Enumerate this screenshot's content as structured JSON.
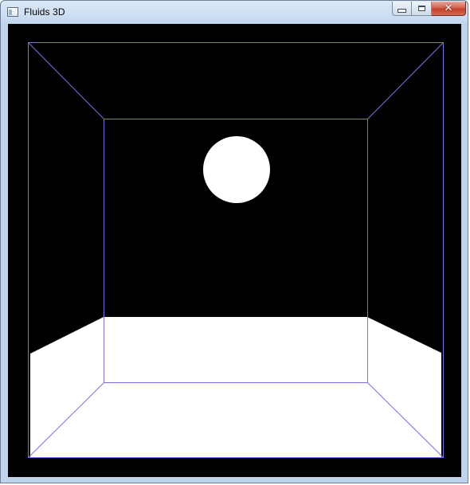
{
  "window": {
    "title": "Fluids 3D",
    "icon": "app-window-icon",
    "controls": {
      "minimize": "minimize-icon",
      "maximize": "maximize-icon",
      "close_glyph": "✕"
    }
  },
  "scene": {
    "background_color": "#000000",
    "box_edge_color": "#7b6fe6",
    "fluid_color": "#ffffff",
    "droplet_color": "#ffffff"
  }
}
